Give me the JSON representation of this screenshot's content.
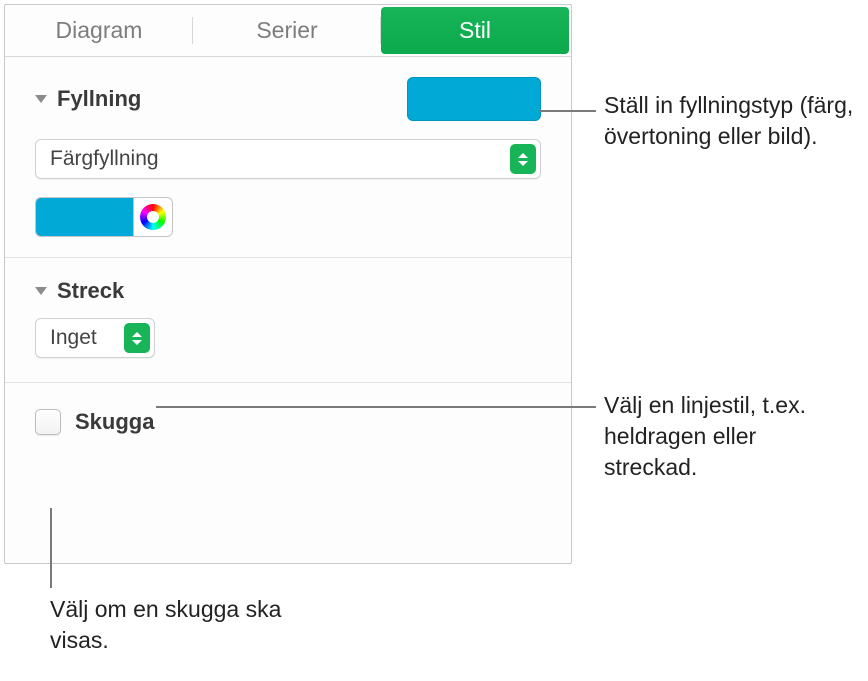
{
  "tabs": {
    "diagram": "Diagram",
    "serier": "Serier",
    "stil": "Stil"
  },
  "colors": {
    "fill": "#00a9d6"
  },
  "sections": {
    "fill": {
      "title": "Fyllning",
      "type_label": "Färgfyllning"
    },
    "stroke": {
      "title": "Streck",
      "style_label": "Inget"
    },
    "shadow": {
      "title": "Skugga"
    }
  },
  "callouts": {
    "fill": "Ställ in fyllningstyp (färg, övertoning eller bild).",
    "stroke": "Välj en linjestil, t.ex. heldragen eller streckad.",
    "shadow": "Välj om en skugga ska visas."
  }
}
